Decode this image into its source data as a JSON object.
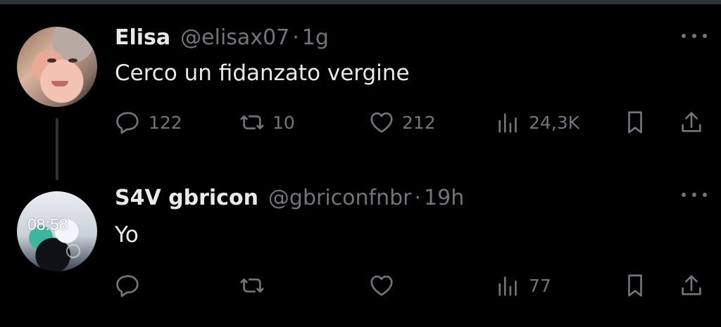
{
  "tweets": [
    {
      "name": "Elisa",
      "handle": "@elisax07",
      "dot": "·",
      "time": "1g",
      "text": "Cerco un fidanzato vergine",
      "stats": {
        "replies": "122",
        "retweets": "10",
        "likes": "212",
        "views": "24,3K"
      }
    },
    {
      "name": "S4V gbricon",
      "handle": "@gbriconfnbr",
      "dot": "·",
      "time": "19h",
      "text": "Yo",
      "avatar_text": "08:58",
      "stats": {
        "replies": "",
        "retweets": "",
        "likes": "",
        "views": "77"
      }
    }
  ],
  "icons": {
    "reply": "reply-icon",
    "retweet": "retweet-icon",
    "like": "heart-icon",
    "views": "views-icon",
    "bookmark": "bookmark-icon",
    "share": "share-icon",
    "more": "more-icon"
  },
  "colors": {
    "background": "#000000",
    "primary_text": "#e7e9ea",
    "secondary_text": "#71767b",
    "divider": "#2f3336"
  }
}
